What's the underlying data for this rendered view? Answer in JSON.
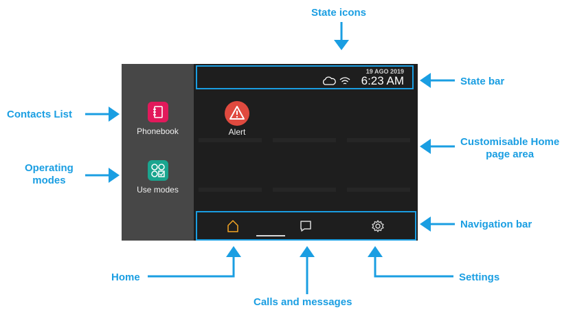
{
  "callouts": {
    "state_icons": "State icons",
    "state_bar": "State bar",
    "contacts_list": "Contacts List",
    "customisable_line1": "Customisable Home",
    "customisable_line2": "page area",
    "operating_line1": "Operating",
    "operating_line2": "modes",
    "navigation_bar": "Navigation bar",
    "home": "Home",
    "settings": "Settings",
    "calls_messages": "Calls and messages"
  },
  "device": {
    "state_bar": {
      "date": "19 AGO 2019",
      "time": "6:23 AM",
      "icons": [
        "cloud-icon",
        "wifi-icon"
      ]
    },
    "sidebar": [
      {
        "label": "Phonebook",
        "icon": "phonebook-icon",
        "color": "#e2195b"
      },
      {
        "label": "Use modes",
        "icon": "use-modes-icon",
        "color": "#1aa58f"
      }
    ],
    "home_apps": [
      {
        "label": "Alert",
        "icon": "alert-icon",
        "color": "#e04a3f"
      }
    ],
    "nav": [
      {
        "name": "home",
        "icon": "home-icon",
        "color": "#f5a623",
        "active": true
      },
      {
        "name": "calls-messages",
        "icon": "message-icon",
        "color": "#d8d8d8"
      },
      {
        "name": "settings",
        "icon": "gear-icon",
        "color": "#d8d8d8"
      }
    ],
    "accent_color": "#1a9ee2"
  }
}
